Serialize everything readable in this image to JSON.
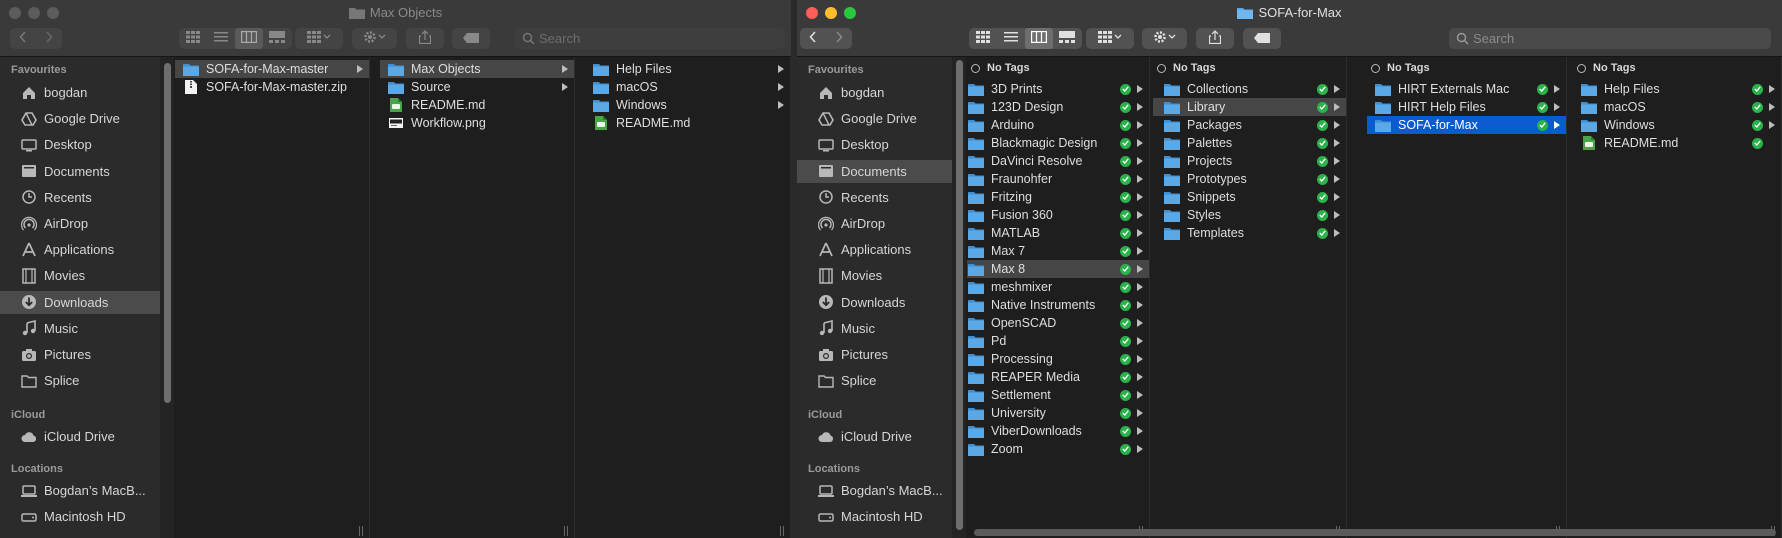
{
  "left_window": {
    "title": "Max Objects",
    "search_placeholder": "Search",
    "sidebar": {
      "favourites_header": "Favourites",
      "favourites": [
        {
          "label": "bogdan",
          "icon": "home-icon"
        },
        {
          "label": "Google Drive",
          "icon": "drive-icon"
        },
        {
          "label": "Desktop",
          "icon": "desktop-icon"
        },
        {
          "label": "Documents",
          "icon": "document-icon"
        },
        {
          "label": "Recents",
          "icon": "clock-icon"
        },
        {
          "label": "AirDrop",
          "icon": "airdrop-icon"
        },
        {
          "label": "Applications",
          "icon": "applications-icon"
        },
        {
          "label": "Movies",
          "icon": "film-icon"
        },
        {
          "label": "Downloads",
          "icon": "download-icon"
        },
        {
          "label": "Music",
          "icon": "music-icon"
        },
        {
          "label": "Pictures",
          "icon": "camera-icon"
        },
        {
          "label": "Splice",
          "icon": "folder-icon"
        }
      ],
      "selected": "Downloads",
      "icloud_header": "iCloud",
      "icloud": [
        {
          "label": "iCloud Drive",
          "icon": "cloud-icon"
        }
      ],
      "locations_header": "Locations",
      "locations": [
        {
          "label": "Bogdan’s MacB...",
          "icon": "laptop-icon"
        },
        {
          "label": "Macintosh HD",
          "icon": "disk-icon"
        }
      ]
    },
    "columns": [
      {
        "items": [
          {
            "label": "SOFA-for-Max-master",
            "type": "folder",
            "arrow": true,
            "selected": true
          },
          {
            "label": "SOFA-for-Max-master.zip",
            "type": "zip"
          }
        ]
      },
      {
        "items": [
          {
            "label": "Max Objects",
            "type": "folder",
            "arrow": true,
            "selected": true
          },
          {
            "label": "Source",
            "type": "folder",
            "arrow": true
          },
          {
            "label": "README.md",
            "type": "md"
          },
          {
            "label": "Workflow.png",
            "type": "image"
          }
        ]
      },
      {
        "items": [
          {
            "label": "Help Files",
            "type": "folder",
            "arrow": true
          },
          {
            "label": "macOS",
            "type": "folder",
            "arrow": true
          },
          {
            "label": "Windows",
            "type": "folder",
            "arrow": true
          },
          {
            "label": "README.md",
            "type": "md"
          }
        ]
      }
    ]
  },
  "right_window": {
    "title": "SOFA-for-Max",
    "search_placeholder": "Search",
    "sidebar": {
      "favourites_header": "Favourites",
      "favourites": [
        {
          "label": "bogdan",
          "icon": "home-icon"
        },
        {
          "label": "Google Drive",
          "icon": "drive-icon"
        },
        {
          "label": "Desktop",
          "icon": "desktop-icon"
        },
        {
          "label": "Documents",
          "icon": "document-icon"
        },
        {
          "label": "Recents",
          "icon": "clock-icon"
        },
        {
          "label": "AirDrop",
          "icon": "airdrop-icon"
        },
        {
          "label": "Applications",
          "icon": "applications-icon"
        },
        {
          "label": "Movies",
          "icon": "film-icon"
        },
        {
          "label": "Downloads",
          "icon": "download-icon"
        },
        {
          "label": "Music",
          "icon": "music-icon"
        },
        {
          "label": "Pictures",
          "icon": "camera-icon"
        },
        {
          "label": "Splice",
          "icon": "folder-icon"
        }
      ],
      "selected": "Documents",
      "icloud_header": "iCloud",
      "icloud": [
        {
          "label": "iCloud Drive",
          "icon": "cloud-icon"
        }
      ],
      "locations_header": "Locations",
      "locations": [
        {
          "label": "Bogdan’s MacB...",
          "icon": "laptop-icon"
        },
        {
          "label": "Macintosh HD",
          "icon": "disk-icon"
        }
      ]
    },
    "columns": [
      {
        "tag_header": "No Tags",
        "items": [
          {
            "label": "3D Prints",
            "type": "folder",
            "check": true,
            "arrow": true
          },
          {
            "label": "123D Design",
            "type": "folder",
            "check": true,
            "arrow": true
          },
          {
            "label": "Arduino",
            "type": "folder",
            "check": true,
            "arrow": true
          },
          {
            "label": "Blackmagic Design",
            "type": "folder",
            "check": true,
            "arrow": true
          },
          {
            "label": "DaVinci Resolve",
            "type": "folder",
            "check": true,
            "arrow": true
          },
          {
            "label": "Fraunohfer",
            "type": "folder",
            "check": true,
            "arrow": true
          },
          {
            "label": "Fritzing",
            "type": "folder",
            "check": true,
            "arrow": true
          },
          {
            "label": "Fusion 360",
            "type": "folder",
            "check": true,
            "arrow": true
          },
          {
            "label": "MATLAB",
            "type": "folder",
            "check": true,
            "arrow": true
          },
          {
            "label": "Max 7",
            "type": "folder",
            "check": true,
            "arrow": true
          },
          {
            "label": "Max 8",
            "type": "folder",
            "check": true,
            "arrow": true,
            "selected": true
          },
          {
            "label": "meshmixer",
            "type": "folder",
            "check": true,
            "arrow": true
          },
          {
            "label": "Native Instruments",
            "type": "folder",
            "check": true,
            "arrow": true
          },
          {
            "label": "OpenSCAD",
            "type": "folder",
            "check": true,
            "arrow": true
          },
          {
            "label": "Pd",
            "type": "folder",
            "check": true,
            "arrow": true
          },
          {
            "label": "Processing",
            "type": "folder",
            "check": true,
            "arrow": true
          },
          {
            "label": "REAPER Media",
            "type": "folder",
            "check": true,
            "arrow": true
          },
          {
            "label": "Settlement",
            "type": "folder",
            "check": true,
            "arrow": true
          },
          {
            "label": "University",
            "type": "folder",
            "check": true,
            "arrow": true
          },
          {
            "label": "ViberDownloads",
            "type": "folder",
            "check": true,
            "arrow": true
          },
          {
            "label": "Zoom",
            "type": "folder",
            "check": true,
            "arrow": true
          }
        ]
      },
      {
        "tag_header": "No Tags",
        "items": [
          {
            "label": "Collections",
            "type": "folder",
            "check": true,
            "arrow": true
          },
          {
            "label": "Library",
            "type": "folder",
            "check": true,
            "arrow": true,
            "selected": true
          },
          {
            "label": "Packages",
            "type": "folder",
            "check": true,
            "arrow": true
          },
          {
            "label": "Palettes",
            "type": "folder",
            "check": true,
            "arrow": true
          },
          {
            "label": "Projects",
            "type": "folder",
            "check": true,
            "arrow": true
          },
          {
            "label": "Prototypes",
            "type": "folder",
            "check": true,
            "arrow": true
          },
          {
            "label": "Snippets",
            "type": "folder",
            "check": true,
            "arrow": true
          },
          {
            "label": "Styles",
            "type": "folder",
            "check": true,
            "arrow": true
          },
          {
            "label": "Templates",
            "type": "folder",
            "check": true,
            "arrow": true
          }
        ]
      },
      {
        "tag_header": "No Tags",
        "items": [
          {
            "label": "HIRT Externals Mac",
            "type": "folder",
            "check": true,
            "arrow": true
          },
          {
            "label": "HIRT Help Files",
            "type": "folder",
            "check": true,
            "arrow": true
          },
          {
            "label": "SOFA-for-Max",
            "type": "folder",
            "check": true,
            "arrow": true,
            "selected": true,
            "active": true
          }
        ]
      },
      {
        "tag_header": "No Tags",
        "items": [
          {
            "label": "Help Files",
            "type": "folder",
            "check": true,
            "arrow": true
          },
          {
            "label": "macOS",
            "type": "folder",
            "check": true,
            "arrow": true
          },
          {
            "label": "Windows",
            "type": "folder",
            "check": true,
            "arrow": true
          },
          {
            "label": "README.md",
            "type": "md",
            "check": true
          }
        ]
      }
    ]
  },
  "colors": {
    "folder": "#5aa9e6",
    "folder_tab": "#3f8fd3",
    "selection_active": "#0a5bd0",
    "check_green": "#2bb24a",
    "close": "#ff5f57",
    "minimize": "#febc2e",
    "zoom": "#28c840"
  }
}
